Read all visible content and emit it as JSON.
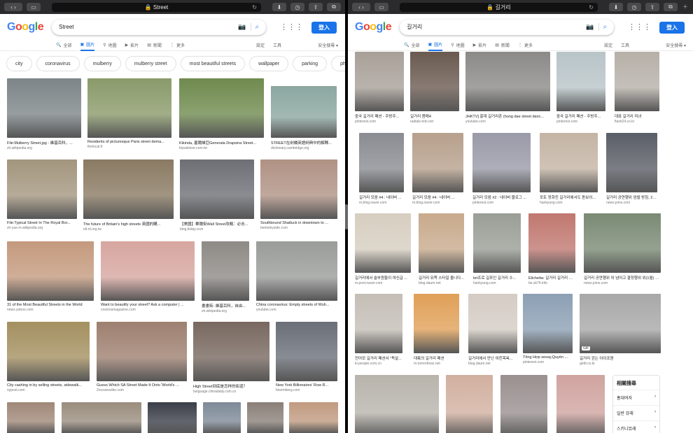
{
  "left": {
    "url": "Street",
    "query": "Street",
    "tabs": [
      "全部",
      "圖片",
      "地圖",
      "影片",
      "新聞",
      "更多"
    ],
    "settings": "設定",
    "tools": "工具",
    "safesearch": "安全搜尋",
    "login": "登入",
    "chips": [
      "city",
      "coronavirus",
      "mulberry",
      "mulberry street",
      "most beautiful streets",
      "wallpaper",
      "parking",
      "philly",
      "philadelphi"
    ],
    "images": [
      {
        "cap": "File:Mulberry Street.jpg - 維基百科，...",
        "src": "zh.wikipedia.org"
      },
      {
        "cap": "Residents of picturesque Paris street dema...",
        "src": "thelocal.fr"
      },
      {
        "cap": "Kikinda, 塞爾維亞Generala Drapsina Street...",
        "src": "tripadvisor.com.tw"
      },
      {
        "cap": "STREET在劍橋英語詞典中的解釋...",
        "src": "dictionary.cambridge.org"
      },
      {
        "cap": "File:Typical Street In The Royal Bor...",
        "src": "zh-yue.m.wikipedia.org"
      },
      {
        "cap": "The future of Britain's high streets 英國的購...",
        "src": "elt.rti.org.tw"
      },
      {
        "cap": "【美國】華爾街Wall Street攻略：必去...",
        "src": "blog.tkday.com"
      },
      {
        "cap": "Southbound Shattuck in downtown to ...",
        "src": "berkeleyside.com"
      },
      {
        "cap": "31 of the Most Beautiful Streets in the World",
        "src": "news.yahoo.com"
      },
      {
        "cap": "Want to beautify your street? Ask a computer | ...",
        "src": "cosmosmagazine.com"
      },
      {
        "cap": "畫畫街- 維基百科，自由...",
        "src": "zh.wikipedia.org"
      },
      {
        "cap": "China coronavirus: Empty streets of Wuh...",
        "src": "youtube.com"
      },
      {
        "cap": "City cashing in by selling streets, sidewalk...",
        "src": "nypost.com"
      },
      {
        "cap": "Guess Which SA Street Made It Onto 'World's ...",
        "src": "2oceansvibe.com"
      },
      {
        "cap": "High Street到底是怎样的街道？",
        "src": "language.chinadaily.com.cn"
      },
      {
        "cap": "New York Billionaires' Row R...",
        "src": "bloomberg.com"
      }
    ]
  },
  "right": {
    "url": "길거리",
    "query": "길거리",
    "tabs": [
      "全部",
      "圖片",
      "地圖",
      "影片",
      "新聞",
      "更多"
    ],
    "settings": "設定",
    "tools": "工具",
    "safesearch": "安全搜尋",
    "login": "登入",
    "images": [
      {
        "cap": "중국 길거리 패션 - 주방주...",
        "src": "pinterest.com"
      },
      {
        "cap": "길거리 몸매4",
        "src": "radials-toto.net"
      },
      {
        "cap": "JHKTV] 홍대 길거리촌 (hong dae street danc...",
        "src": "youtube.com"
      },
      {
        "cap": "중국 길거리 패션 - 주방주...",
        "src": "pinterest.com"
      },
      {
        "cap": "대표 길거리 미녀",
        "src": "flash24.co.kr"
      },
      {
        "cap": "길거리 모음 #4 : 네이버 ...",
        "src": "m.blog.naver.com"
      },
      {
        "cap": "길거리 모음 #4 : 네이버 ...",
        "src": "m.blog.naver.com"
      },
      {
        "cap": "길거리 모음 #2 : 네이버 블로그 ...",
        "src": "pinterest.com"
      },
      {
        "cap": "포토 정화진 길거리에서도 돋보이...",
        "src": "hankyung.com"
      },
      {
        "cap": "길거리 공연행위 엄벌 방침, 2개...",
        "src": "news.joins.com"
      },
      {
        "cap": "길거리에서 슬부원들이 여신급 ...",
        "src": "m.post.naver.com"
      },
      {
        "cap": "길거리 뒤쪽 스타일 올니다...",
        "src": "blog.daum.net"
      },
      {
        "cap": "brt프로 길포인 길거리 수...",
        "src": "hankyung.com"
      },
      {
        "cap": "Elichetta: 길거리 길거리 엘링즈...",
        "src": "be.sk74.info"
      },
      {
        "cap": "길거리 공연행위 외 넘어고 결정행위 위(1월) 여잉 ...",
        "src": "news.joins.com"
      },
      {
        "cap": "전어모 길거리 패션서 \"독살...",
        "src": "kr.people.com.cn"
      },
      {
        "cap": "대륙의 길거리 패션",
        "src": "m.torrentmax.net"
      },
      {
        "cap": "길거리에서 만난 여친목욕...",
        "src": "blog.daum.net"
      },
      {
        "cap": "Tổng Hợp sexay,Quyến ...",
        "src": "pinterest.com"
      },
      {
        "cap": "길거리 걷는 아이조원",
        "src": "gettt.co.kr"
      }
    ],
    "gif_badge": "GIF",
    "related": {
      "title": "相關搜尋",
      "items": [
        "홍대여자",
        "일반 뮤래",
        "스키니뮤래"
      ]
    }
  }
}
